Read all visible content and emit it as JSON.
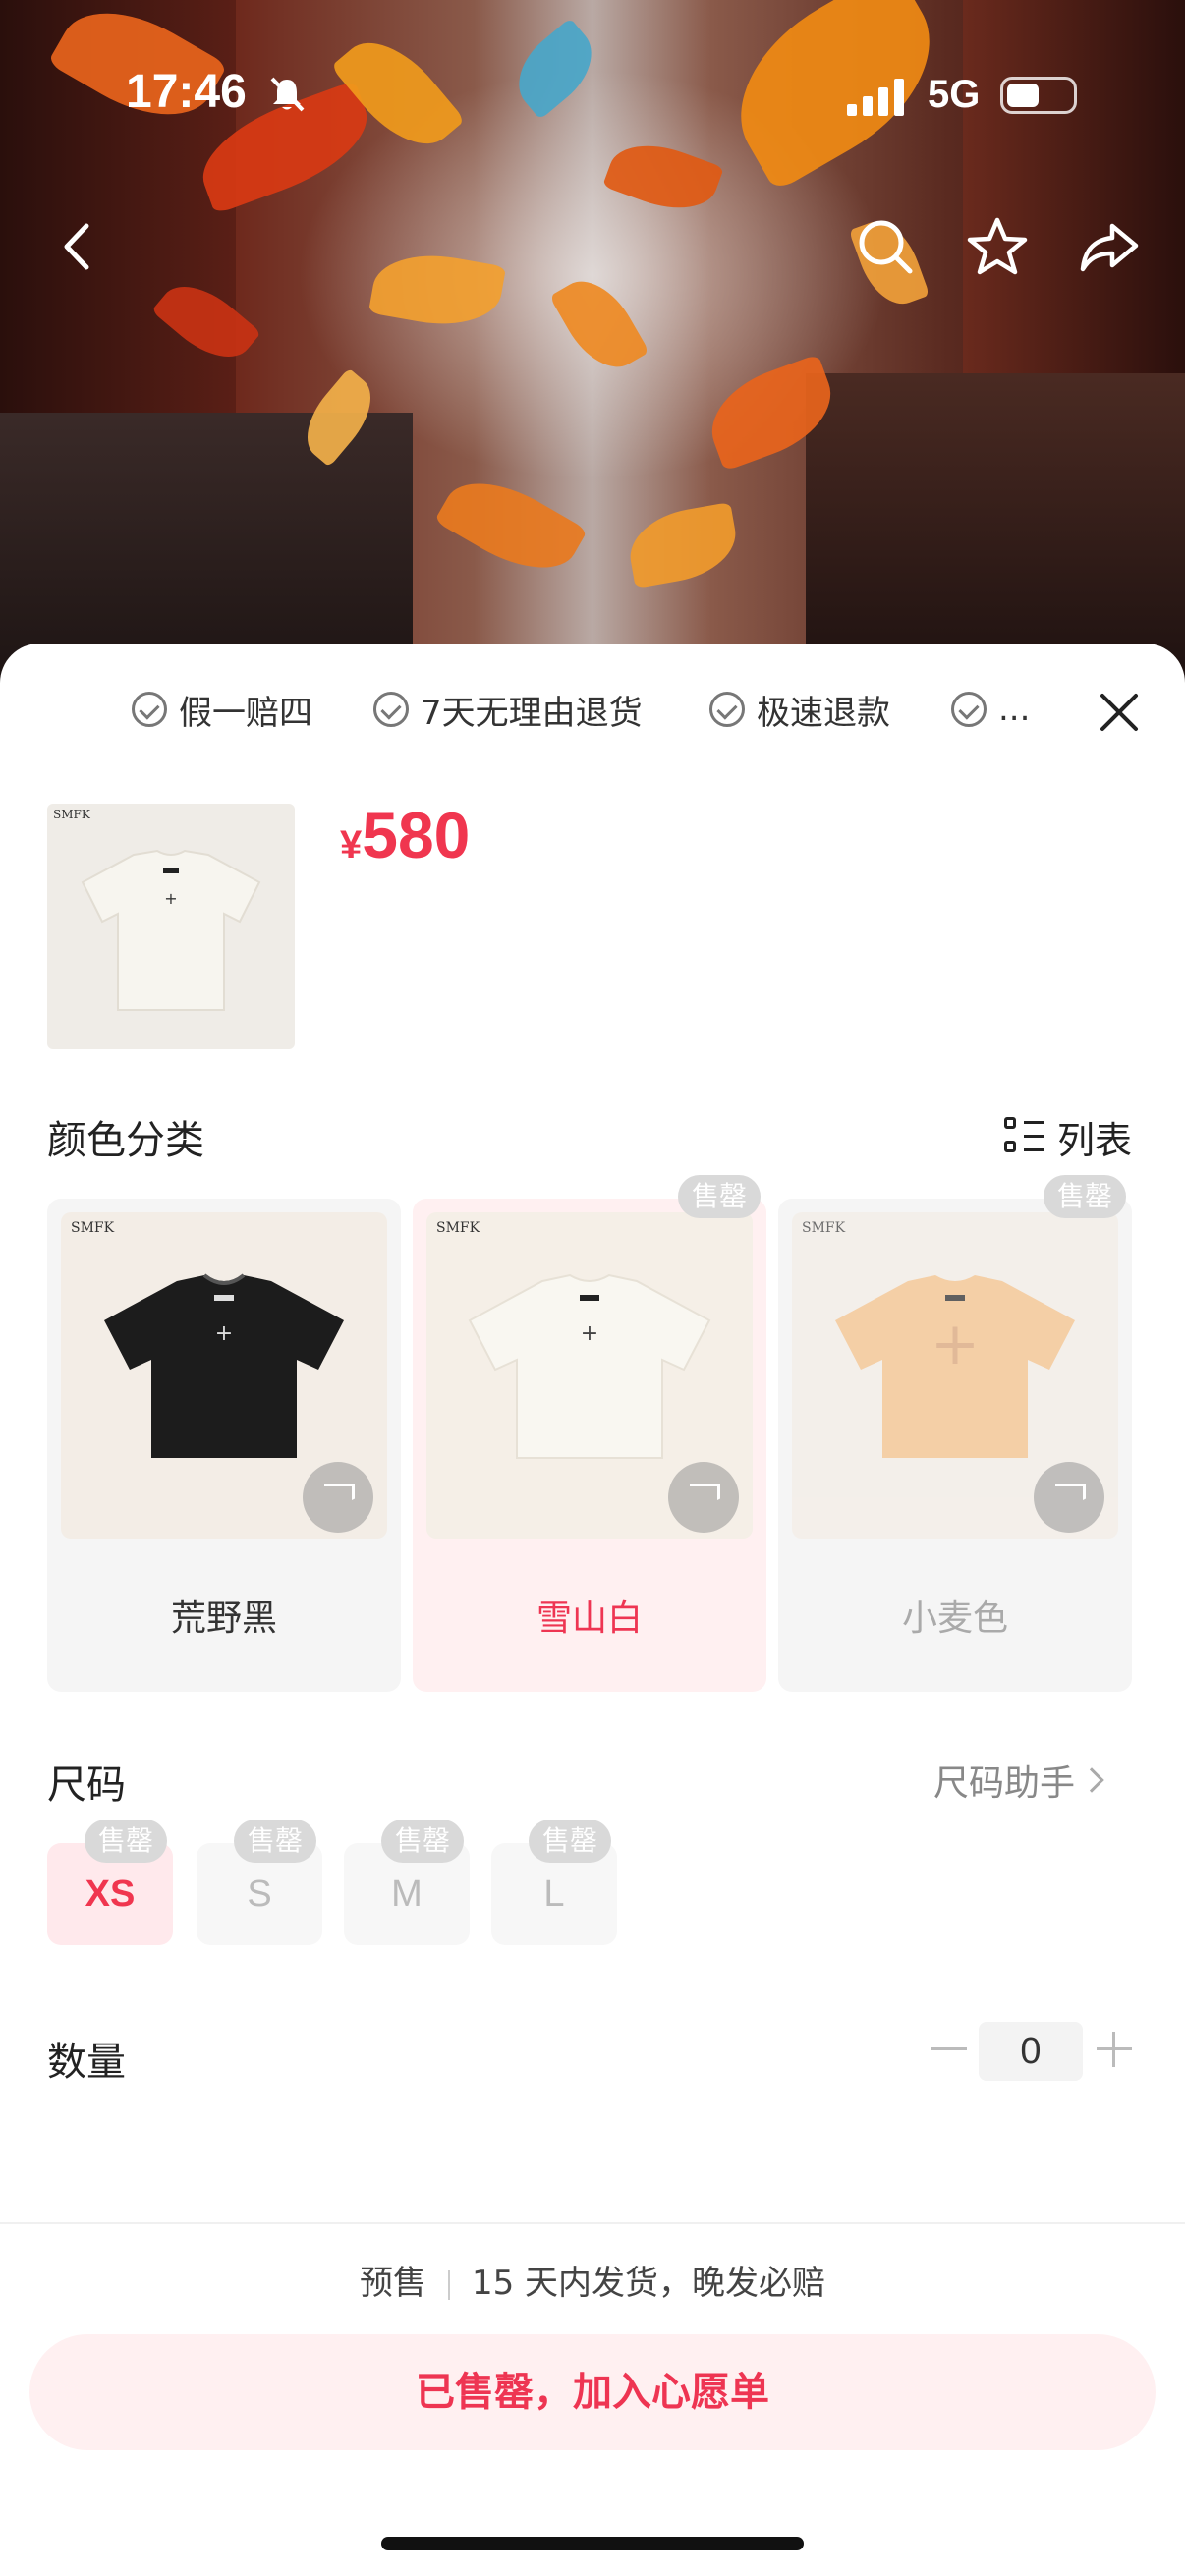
{
  "status_bar": {
    "time": "17:46",
    "network": "5G"
  },
  "guarantees": [
    "假一赔四",
    "7天无理由退货",
    "极速退款",
    "..."
  ],
  "product": {
    "price_currency": "¥",
    "price": "580",
    "brand": "SMFK"
  },
  "color_section": {
    "title": "颜色分类",
    "list_label": "列表",
    "options": [
      {
        "label": "荒野黑",
        "badge": "",
        "selected": false
      },
      {
        "label": "雪山白",
        "badge": "售罄",
        "selected": true
      },
      {
        "label": "小麦色",
        "badge": "售罄",
        "selected": false
      }
    ]
  },
  "size_section": {
    "title": "尺码",
    "helper": "尺码助手",
    "options": [
      {
        "label": "XS",
        "badge": "售罄",
        "selected": true
      },
      {
        "label": "S",
        "badge": "售罄",
        "selected": false
      },
      {
        "label": "M",
        "badge": "售罄",
        "selected": false
      },
      {
        "label": "L",
        "badge": "售罄",
        "selected": false
      }
    ]
  },
  "quantity": {
    "title": "数量",
    "value": "0"
  },
  "shipping": {
    "tag": "预售",
    "text": "15 天内发货，晚发必赔"
  },
  "cta": {
    "label": "已售罄，加入心愿单"
  },
  "colors": {
    "accent": "#f0364f",
    "badge": "#d9d9d9",
    "selected_bg": "#fff0f1"
  }
}
